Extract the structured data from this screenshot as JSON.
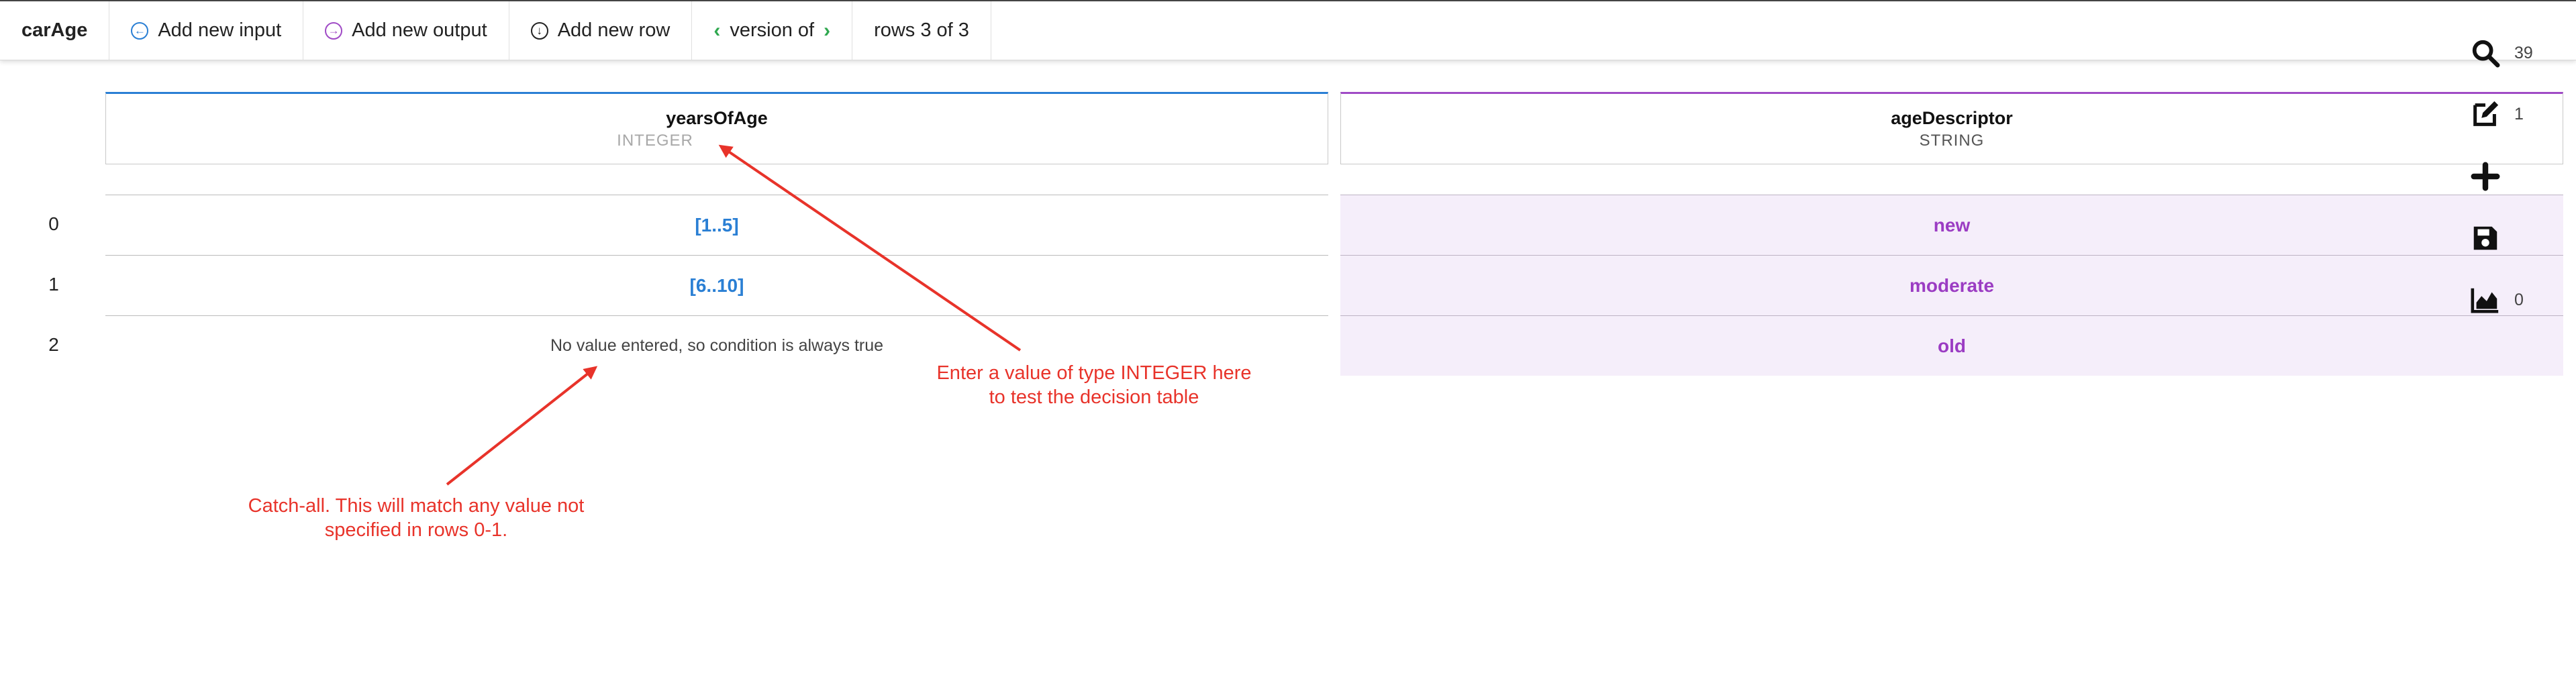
{
  "toolbar": {
    "title": "carAge",
    "add_input": "Add new input",
    "add_output": "Add new output",
    "add_row": "Add new row",
    "version_label": "version of",
    "rows_label": "rows 3 of 3"
  },
  "table": {
    "input_column": {
      "name": "yearsOfAge",
      "type": "INTEGER"
    },
    "output_column": {
      "name": "ageDescriptor",
      "type": "STRING"
    },
    "rows": [
      {
        "index": "0",
        "input": "[1..5]",
        "output": "new"
      },
      {
        "index": "1",
        "input": "[6..10]",
        "output": "moderate"
      },
      {
        "index": "2",
        "input": "No value entered, so condition is always true",
        "output": "old"
      }
    ]
  },
  "side_tools": {
    "search_count": "39",
    "edit_count": "1",
    "chart_count": "0"
  },
  "annotations": {
    "test_hint": "Enter a value of type INTEGER here\nto test the decision table",
    "catch_all": "Catch-all. This will match any value not\nspecified in rows 0-1."
  },
  "colors": {
    "input_accent": "#2a7fd4",
    "output_accent": "#a04bc6",
    "output_cell_bg": "#f5eefa",
    "annotation": "#e8332a",
    "nav_chevron": "#2fa84f"
  }
}
